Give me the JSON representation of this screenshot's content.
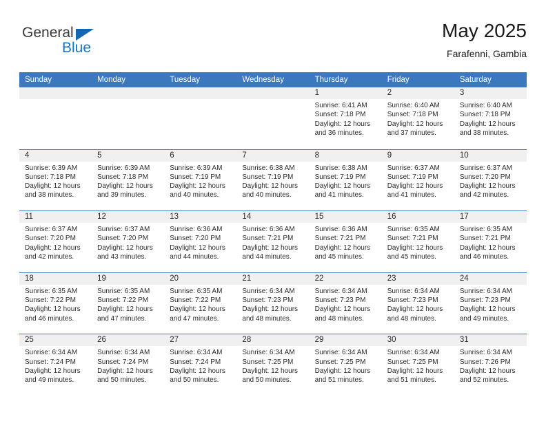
{
  "brand": {
    "name_top": "General",
    "name_bottom": "Blue",
    "triangle_color": "#1565b0",
    "blue_color": "#1874c4"
  },
  "header": {
    "title": "May 2025",
    "subtitle": "Farafenni, Gambia"
  },
  "theme": {
    "header_bg": "#3b78bf",
    "header_text": "#ffffff",
    "day_band_bg": "#f0f0f0",
    "row_divider": "#3b78bf"
  },
  "weekdays": [
    "Sunday",
    "Monday",
    "Tuesday",
    "Wednesday",
    "Thursday",
    "Friday",
    "Saturday"
  ],
  "weeks": [
    [
      {
        "day": "",
        "empty": true
      },
      {
        "day": "",
        "empty": true
      },
      {
        "day": "",
        "empty": true
      },
      {
        "day": "",
        "empty": true
      },
      {
        "day": "1",
        "sunrise": "Sunrise: 6:41 AM",
        "sunset": "Sunset: 7:18 PM",
        "daylight1": "Daylight: 12 hours",
        "daylight2": "and 36 minutes."
      },
      {
        "day": "2",
        "sunrise": "Sunrise: 6:40 AM",
        "sunset": "Sunset: 7:18 PM",
        "daylight1": "Daylight: 12 hours",
        "daylight2": "and 37 minutes."
      },
      {
        "day": "3",
        "sunrise": "Sunrise: 6:40 AM",
        "sunset": "Sunset: 7:18 PM",
        "daylight1": "Daylight: 12 hours",
        "daylight2": "and 38 minutes."
      }
    ],
    [
      {
        "day": "4",
        "sunrise": "Sunrise: 6:39 AM",
        "sunset": "Sunset: 7:18 PM",
        "daylight1": "Daylight: 12 hours",
        "daylight2": "and 38 minutes."
      },
      {
        "day": "5",
        "sunrise": "Sunrise: 6:39 AM",
        "sunset": "Sunset: 7:18 PM",
        "daylight1": "Daylight: 12 hours",
        "daylight2": "and 39 minutes."
      },
      {
        "day": "6",
        "sunrise": "Sunrise: 6:39 AM",
        "sunset": "Sunset: 7:19 PM",
        "daylight1": "Daylight: 12 hours",
        "daylight2": "and 40 minutes."
      },
      {
        "day": "7",
        "sunrise": "Sunrise: 6:38 AM",
        "sunset": "Sunset: 7:19 PM",
        "daylight1": "Daylight: 12 hours",
        "daylight2": "and 40 minutes."
      },
      {
        "day": "8",
        "sunrise": "Sunrise: 6:38 AM",
        "sunset": "Sunset: 7:19 PM",
        "daylight1": "Daylight: 12 hours",
        "daylight2": "and 41 minutes."
      },
      {
        "day": "9",
        "sunrise": "Sunrise: 6:37 AM",
        "sunset": "Sunset: 7:19 PM",
        "daylight1": "Daylight: 12 hours",
        "daylight2": "and 41 minutes."
      },
      {
        "day": "10",
        "sunrise": "Sunrise: 6:37 AM",
        "sunset": "Sunset: 7:20 PM",
        "daylight1": "Daylight: 12 hours",
        "daylight2": "and 42 minutes."
      }
    ],
    [
      {
        "day": "11",
        "sunrise": "Sunrise: 6:37 AM",
        "sunset": "Sunset: 7:20 PM",
        "daylight1": "Daylight: 12 hours",
        "daylight2": "and 42 minutes."
      },
      {
        "day": "12",
        "sunrise": "Sunrise: 6:37 AM",
        "sunset": "Sunset: 7:20 PM",
        "daylight1": "Daylight: 12 hours",
        "daylight2": "and 43 minutes."
      },
      {
        "day": "13",
        "sunrise": "Sunrise: 6:36 AM",
        "sunset": "Sunset: 7:20 PM",
        "daylight1": "Daylight: 12 hours",
        "daylight2": "and 44 minutes."
      },
      {
        "day": "14",
        "sunrise": "Sunrise: 6:36 AM",
        "sunset": "Sunset: 7:21 PM",
        "daylight1": "Daylight: 12 hours",
        "daylight2": "and 44 minutes."
      },
      {
        "day": "15",
        "sunrise": "Sunrise: 6:36 AM",
        "sunset": "Sunset: 7:21 PM",
        "daylight1": "Daylight: 12 hours",
        "daylight2": "and 45 minutes."
      },
      {
        "day": "16",
        "sunrise": "Sunrise: 6:35 AM",
        "sunset": "Sunset: 7:21 PM",
        "daylight1": "Daylight: 12 hours",
        "daylight2": "and 45 minutes."
      },
      {
        "day": "17",
        "sunrise": "Sunrise: 6:35 AM",
        "sunset": "Sunset: 7:21 PM",
        "daylight1": "Daylight: 12 hours",
        "daylight2": "and 46 minutes."
      }
    ],
    [
      {
        "day": "18",
        "sunrise": "Sunrise: 6:35 AM",
        "sunset": "Sunset: 7:22 PM",
        "daylight1": "Daylight: 12 hours",
        "daylight2": "and 46 minutes."
      },
      {
        "day": "19",
        "sunrise": "Sunrise: 6:35 AM",
        "sunset": "Sunset: 7:22 PM",
        "daylight1": "Daylight: 12 hours",
        "daylight2": "and 47 minutes."
      },
      {
        "day": "20",
        "sunrise": "Sunrise: 6:35 AM",
        "sunset": "Sunset: 7:22 PM",
        "daylight1": "Daylight: 12 hours",
        "daylight2": "and 47 minutes."
      },
      {
        "day": "21",
        "sunrise": "Sunrise: 6:34 AM",
        "sunset": "Sunset: 7:23 PM",
        "daylight1": "Daylight: 12 hours",
        "daylight2": "and 48 minutes."
      },
      {
        "day": "22",
        "sunrise": "Sunrise: 6:34 AM",
        "sunset": "Sunset: 7:23 PM",
        "daylight1": "Daylight: 12 hours",
        "daylight2": "and 48 minutes."
      },
      {
        "day": "23",
        "sunrise": "Sunrise: 6:34 AM",
        "sunset": "Sunset: 7:23 PM",
        "daylight1": "Daylight: 12 hours",
        "daylight2": "and 48 minutes."
      },
      {
        "day": "24",
        "sunrise": "Sunrise: 6:34 AM",
        "sunset": "Sunset: 7:23 PM",
        "daylight1": "Daylight: 12 hours",
        "daylight2": "and 49 minutes."
      }
    ],
    [
      {
        "day": "25",
        "sunrise": "Sunrise: 6:34 AM",
        "sunset": "Sunset: 7:24 PM",
        "daylight1": "Daylight: 12 hours",
        "daylight2": "and 49 minutes."
      },
      {
        "day": "26",
        "sunrise": "Sunrise: 6:34 AM",
        "sunset": "Sunset: 7:24 PM",
        "daylight1": "Daylight: 12 hours",
        "daylight2": "and 50 minutes."
      },
      {
        "day": "27",
        "sunrise": "Sunrise: 6:34 AM",
        "sunset": "Sunset: 7:24 PM",
        "daylight1": "Daylight: 12 hours",
        "daylight2": "and 50 minutes."
      },
      {
        "day": "28",
        "sunrise": "Sunrise: 6:34 AM",
        "sunset": "Sunset: 7:25 PM",
        "daylight1": "Daylight: 12 hours",
        "daylight2": "and 50 minutes."
      },
      {
        "day": "29",
        "sunrise": "Sunrise: 6:34 AM",
        "sunset": "Sunset: 7:25 PM",
        "daylight1": "Daylight: 12 hours",
        "daylight2": "and 51 minutes."
      },
      {
        "day": "30",
        "sunrise": "Sunrise: 6:34 AM",
        "sunset": "Sunset: 7:25 PM",
        "daylight1": "Daylight: 12 hours",
        "daylight2": "and 51 minutes."
      },
      {
        "day": "31",
        "sunrise": "Sunrise: 6:34 AM",
        "sunset": "Sunset: 7:26 PM",
        "daylight1": "Daylight: 12 hours",
        "daylight2": "and 52 minutes."
      }
    ]
  ]
}
